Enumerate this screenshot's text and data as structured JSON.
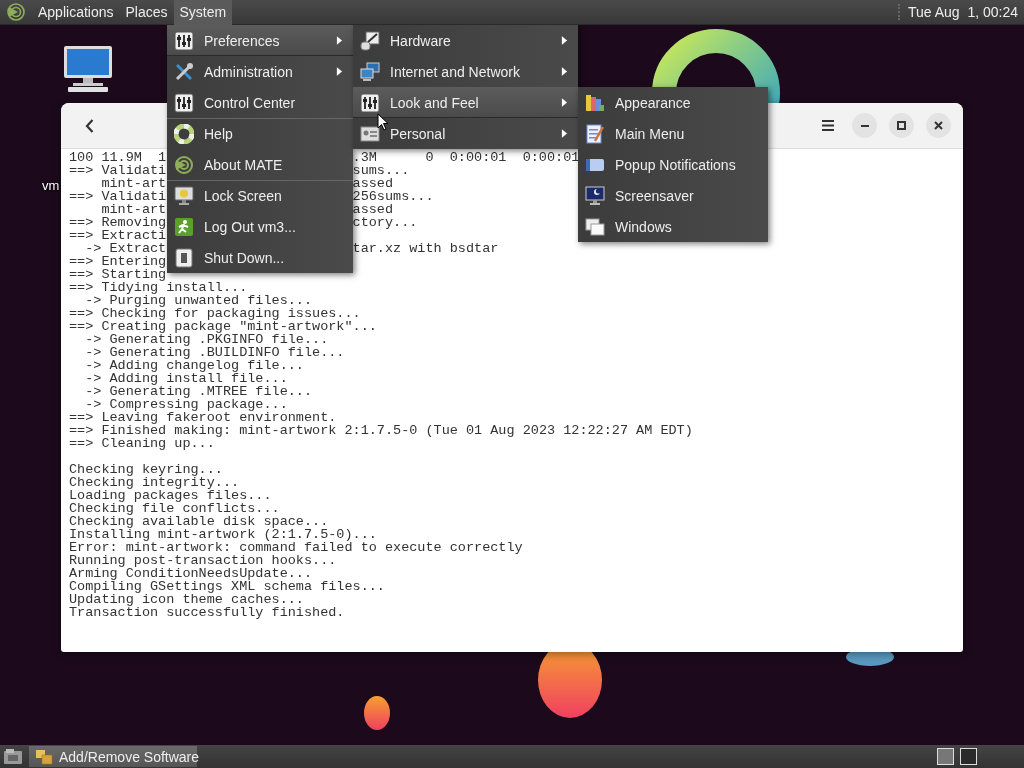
{
  "top_panel": {
    "menus": [
      {
        "label": "Applications",
        "selected": false
      },
      {
        "label": "Places",
        "selected": false
      },
      {
        "label": "System",
        "selected": true
      }
    ],
    "clock": "Tue Aug  1, 00:24"
  },
  "desktop": {
    "icon_labels": [
      "vm"
    ]
  },
  "terminal_window": {
    "lines": [
      {
        "kind": "split",
        "text": "100 11.9M  1",
        "text_right": ".3M      0  0:00:01  0:00:01"
      },
      {
        "kind": "split",
        "text": "==> Validati",
        "text_right": "sums..."
      },
      {
        "kind": "split",
        "text": "    mint-art",
        "text_right": "assed"
      },
      {
        "kind": "split",
        "text": "==> Validati",
        "text_right": "256sums..."
      },
      {
        "kind": "split",
        "text": "    mint-art",
        "text_right": "assed"
      },
      {
        "kind": "split",
        "text": "==> Removing",
        "text_right": "ctory..."
      },
      {
        "kind": "line",
        "text": "==> Extracti"
      },
      {
        "kind": "split",
        "text": "  -> Extract",
        "text_right": "tar.xz with bsdtar"
      },
      {
        "kind": "line",
        "text": "==> Entering"
      },
      {
        "kind": "line",
        "text": "==> Starting"
      },
      {
        "kind": "line",
        "text": "==> Tidying install..."
      },
      {
        "kind": "line",
        "text": "  -> Purging unwanted files..."
      },
      {
        "kind": "line",
        "text": "==> Checking for packaging issues..."
      },
      {
        "kind": "line",
        "text": "==> Creating package \"mint-artwork\"..."
      },
      {
        "kind": "line",
        "text": "  -> Generating .PKGINFO file..."
      },
      {
        "kind": "line",
        "text": "  -> Generating .BUILDINFO file..."
      },
      {
        "kind": "line",
        "text": "  -> Adding changelog file..."
      },
      {
        "kind": "line",
        "text": "  -> Adding install file..."
      },
      {
        "kind": "line",
        "text": "  -> Generating .MTREE file..."
      },
      {
        "kind": "line",
        "text": "  -> Compressing package..."
      },
      {
        "kind": "line",
        "text": "==> Leaving fakeroot environment."
      },
      {
        "kind": "line",
        "text": "==> Finished making: mint-artwork 2:1.7.5-0 (Tue 01 Aug 2023 12:22:27 AM EDT)"
      },
      {
        "kind": "line",
        "text": "==> Cleaning up..."
      },
      {
        "kind": "blank"
      },
      {
        "kind": "line",
        "text": "Checking keyring..."
      },
      {
        "kind": "line",
        "text": "Checking integrity..."
      },
      {
        "kind": "line",
        "text": "Loading packages files..."
      },
      {
        "kind": "line",
        "text": "Checking file conflicts..."
      },
      {
        "kind": "line",
        "text": "Checking available disk space..."
      },
      {
        "kind": "line",
        "text": "Installing mint-artwork (2:1.7.5-0)..."
      },
      {
        "kind": "line",
        "text": "Error: mint-artwork: command failed to execute correctly"
      },
      {
        "kind": "line",
        "text": "Running post-transaction hooks..."
      },
      {
        "kind": "line",
        "text": "Arming ConditionNeedsUpdate..."
      },
      {
        "kind": "line",
        "text": "Compiling GSettings XML schema files..."
      },
      {
        "kind": "line",
        "text": "Updating icon theme caches..."
      },
      {
        "kind": "line",
        "text": "Transaction successfully finished."
      }
    ]
  },
  "system_menu": {
    "items": [
      {
        "label": "Preferences",
        "submenu": true,
        "selected": true,
        "separator_before": false
      },
      {
        "label": "Administration",
        "submenu": true,
        "selected": false,
        "separator_before": false
      },
      {
        "label": "Control Center",
        "submenu": false,
        "selected": false,
        "separator_before": false
      },
      {
        "label": "Help",
        "submenu": false,
        "selected": false,
        "separator_before": true
      },
      {
        "label": "About MATE",
        "submenu": false,
        "selected": false,
        "separator_before": false
      },
      {
        "label": "Lock Screen",
        "submenu": false,
        "selected": false,
        "separator_before": true
      },
      {
        "label": "Log Out vm3...",
        "submenu": false,
        "selected": false,
        "separator_before": false
      },
      {
        "label": "Shut Down...",
        "submenu": false,
        "selected": false,
        "separator_before": false
      }
    ]
  },
  "preferences_menu": {
    "items": [
      {
        "label": "Hardware",
        "submenu": true,
        "selected": false,
        "separator_before": false
      },
      {
        "label": "Internet and Network",
        "submenu": true,
        "selected": false,
        "separator_before": false
      },
      {
        "label": "Look and Feel",
        "submenu": true,
        "selected": true,
        "separator_before": false
      },
      {
        "label": "Personal",
        "submenu": true,
        "selected": false,
        "separator_before": false
      }
    ]
  },
  "look_and_feel_menu": {
    "items": [
      {
        "label": "Appearance",
        "submenu": false,
        "selected": false,
        "separator_before": false
      },
      {
        "label": "Main Menu",
        "submenu": false,
        "selected": false,
        "separator_before": false
      },
      {
        "label": "Popup Notifications",
        "submenu": false,
        "selected": false,
        "separator_before": false
      },
      {
        "label": "Screensaver",
        "submenu": false,
        "selected": false,
        "separator_before": false
      },
      {
        "label": "Windows",
        "submenu": false,
        "selected": false,
        "separator_before": false
      }
    ]
  },
  "taskbar": {
    "tasks": [
      {
        "label": "Add/Remove Software",
        "selected": true
      }
    ],
    "workspaces": [
      {
        "selected": true
      },
      {
        "selected": false
      }
    ]
  }
}
